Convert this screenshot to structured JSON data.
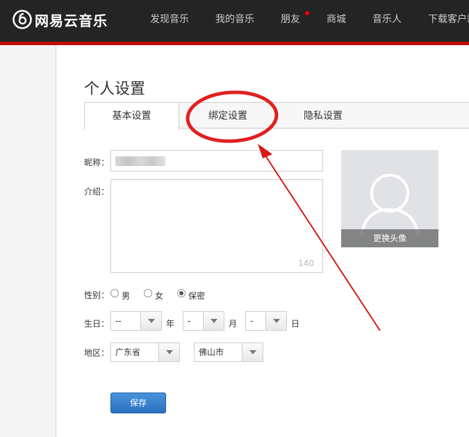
{
  "brand": {
    "name": "网易云音乐",
    "accent_red": "#c20c0c",
    "topbar_bg": "#242424"
  },
  "nav": {
    "items": [
      {
        "label": "发现音乐"
      },
      {
        "label": "我的音乐"
      },
      {
        "label": "朋友"
      },
      {
        "label": "商城"
      },
      {
        "label": "音乐人"
      },
      {
        "label": "下载客户端"
      }
    ]
  },
  "page": {
    "title": "个人设置"
  },
  "tabs": [
    {
      "label": "基本设置",
      "active": true
    },
    {
      "label": "绑定设置",
      "active": false
    },
    {
      "label": "隐私设置",
      "active": false
    }
  ],
  "form": {
    "nickname_label": "昵称：",
    "intro_label": "介绍：",
    "intro_counter": "140",
    "gender_label": "性别：",
    "gender_options": [
      "男",
      "女",
      "保密"
    ],
    "gender_selected": "保密",
    "birthday_label": "生日：",
    "birthday": {
      "year_value": "--",
      "year_unit": "年",
      "month_value": "-",
      "month_unit": "月",
      "day_value": "-",
      "day_unit": "日"
    },
    "region_label": "地区：",
    "province_value": "广东省",
    "city_value": "佛山市",
    "save_label": "保存"
  },
  "avatar": {
    "change_label": "更换头像"
  },
  "annotation": {
    "color": "#e02020",
    "shape": "circle-and-arrow",
    "target": "绑定设置"
  }
}
